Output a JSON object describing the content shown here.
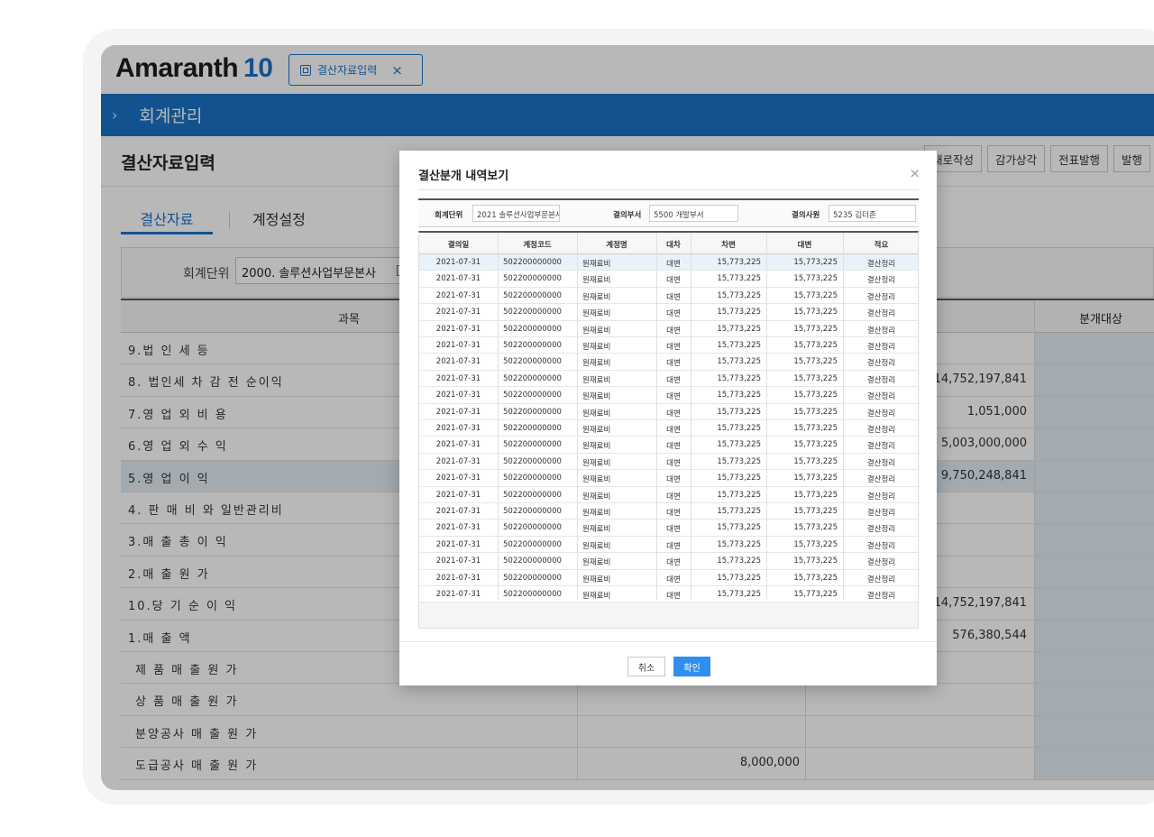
{
  "app": {
    "logo_name": "Amaranth",
    "logo_version": "10"
  },
  "open_tab": {
    "label": "결산자료입력",
    "close": "×"
  },
  "menu": {
    "chevron": "›",
    "title": "회계관리"
  },
  "page": {
    "title": "결산자료입력"
  },
  "actions": [
    "새로작성",
    "감가상각",
    "전표발행",
    "발행"
  ],
  "subtabs": {
    "active": "결산자료",
    "other": "계정설정"
  },
  "filter": {
    "label": "회계단위",
    "value": "2000. 솔루션사업부문본사"
  },
  "grid": {
    "header": {
      "col1": "과목",
      "col4": "분개대상"
    },
    "rows": [
      {
        "name": "9.법 인 세 등",
        "c2": "",
        "c3": "",
        "hl": false
      },
      {
        "name": "8. 법인세 차 감 전 순이익",
        "c2": "",
        "c3": "14,752,197,841",
        "hl": false
      },
      {
        "name": "7.영 업 외 비 용",
        "c2": "",
        "c3": "1,051,000",
        "hl": false
      },
      {
        "name": "6.영 업 외 수 익",
        "c2": "",
        "c3": "5,003,000,000",
        "hl": false
      },
      {
        "name": "5.영 업 이 익",
        "c2": "",
        "c3": "9,750,248,841",
        "hl": true
      },
      {
        "name": "4. 판 매 비 와 일반관리비",
        "c2": "",
        "c3": "",
        "hl": false
      },
      {
        "name": "3.매 출 총 이 익",
        "c2": "",
        "c3": "",
        "hl": false
      },
      {
        "name": "2.매 출 원 가",
        "c2": "",
        "c3": "",
        "hl": false
      },
      {
        "name": "10.당 기 순 이 익",
        "c2": "",
        "c3": "14,752,197,841",
        "hl": false
      },
      {
        "name": "1.매 출 액",
        "c2": "",
        "c3": "576,380,544",
        "hl": false
      },
      {
        "name": "제 품 매 출 원 가",
        "c2": "",
        "c3": "",
        "hl": false
      },
      {
        "name": "상 품 매 출 원 가",
        "c2": "",
        "c3": "",
        "hl": false
      },
      {
        "name": "분양공사 매 출 원 가",
        "c2": "",
        "c3": "",
        "hl": false
      },
      {
        "name": "도급공사 매 출 원 가",
        "c2": "8,000,000",
        "c3": "",
        "hl": false
      }
    ]
  },
  "modal": {
    "title": "결산분개 내역보기",
    "close": "×",
    "info": {
      "unit_label": "회계단위",
      "unit_value": "2021 솔루션사업부문본사",
      "dept_label": "결의부서",
      "dept_value": "5500 개발부서",
      "user_label": "결의사원",
      "user_value": "5235 김더존"
    },
    "columns": [
      "결의일",
      "계정코드",
      "계정명",
      "대차",
      "차변",
      "대변",
      "적요"
    ],
    "rows": [
      [
        "2021-07-31",
        "502200000000",
        "원재료비",
        "대변",
        "15,773,225",
        "15,773,225",
        "결산정리"
      ],
      [
        "2021-07-31",
        "502200000000",
        "원재료비",
        "대변",
        "15,773,225",
        "15,773,225",
        "결산정리"
      ],
      [
        "2021-07-31",
        "502200000000",
        "원재료비",
        "대변",
        "15,773,225",
        "15,773,225",
        "결산정리"
      ],
      [
        "2021-07-31",
        "502200000000",
        "원재료비",
        "대변",
        "15,773,225",
        "15,773,225",
        "결산정리"
      ],
      [
        "2021-07-31",
        "502200000000",
        "원재료비",
        "대변",
        "15,773,225",
        "15,773,225",
        "결산정리"
      ],
      [
        "2021-07-31",
        "502200000000",
        "원재료비",
        "대변",
        "15,773,225",
        "15,773,225",
        "결산정리"
      ],
      [
        "2021-07-31",
        "502200000000",
        "원재료비",
        "대변",
        "15,773,225",
        "15,773,225",
        "결산정리"
      ],
      [
        "2021-07-31",
        "502200000000",
        "원재료비",
        "대변",
        "15,773,225",
        "15,773,225",
        "결산정리"
      ],
      [
        "2021-07-31",
        "502200000000",
        "원재료비",
        "대변",
        "15,773,225",
        "15,773,225",
        "결산정리"
      ],
      [
        "2021-07-31",
        "502200000000",
        "원재료비",
        "대변",
        "15,773,225",
        "15,773,225",
        "결산정리"
      ],
      [
        "2021-07-31",
        "502200000000",
        "원재료비",
        "대변",
        "15,773,225",
        "15,773,225",
        "결산정리"
      ],
      [
        "2021-07-31",
        "502200000000",
        "원재료비",
        "대변",
        "15,773,225",
        "15,773,225",
        "결산정리"
      ],
      [
        "2021-07-31",
        "502200000000",
        "원재료비",
        "대변",
        "15,773,225",
        "15,773,225",
        "결산정리"
      ],
      [
        "2021-07-31",
        "502200000000",
        "원재료비",
        "대변",
        "15,773,225",
        "15,773,225",
        "결산정리"
      ],
      [
        "2021-07-31",
        "502200000000",
        "원재료비",
        "대변",
        "15,773,225",
        "15,773,225",
        "결산정리"
      ],
      [
        "2021-07-31",
        "502200000000",
        "원재료비",
        "대변",
        "15,773,225",
        "15,773,225",
        "결산정리"
      ],
      [
        "2021-07-31",
        "502200000000",
        "원재료비",
        "대변",
        "15,773,225",
        "15,773,225",
        "결산정리"
      ],
      [
        "2021-07-31",
        "502200000000",
        "원재료비",
        "대변",
        "15,773,225",
        "15,773,225",
        "결산정리"
      ],
      [
        "2021-07-31",
        "502200000000",
        "원재료비",
        "대변",
        "15,773,225",
        "15,773,225",
        "결산정리"
      ],
      [
        "2021-07-31",
        "502200000000",
        "원재료비",
        "대변",
        "15,773,225",
        "15,773,225",
        "결산정리"
      ],
      [
        "2021-07-31",
        "502200000000",
        "원재료비",
        "대변",
        "15,773,225",
        "15,773,225",
        "결산정리"
      ]
    ],
    "cancel": "취소",
    "ok": "확인"
  },
  "colors": {
    "brand_blue": "#1a73c7",
    "highlight": "#e2eef6",
    "ok_button": "#2f8ff0"
  }
}
